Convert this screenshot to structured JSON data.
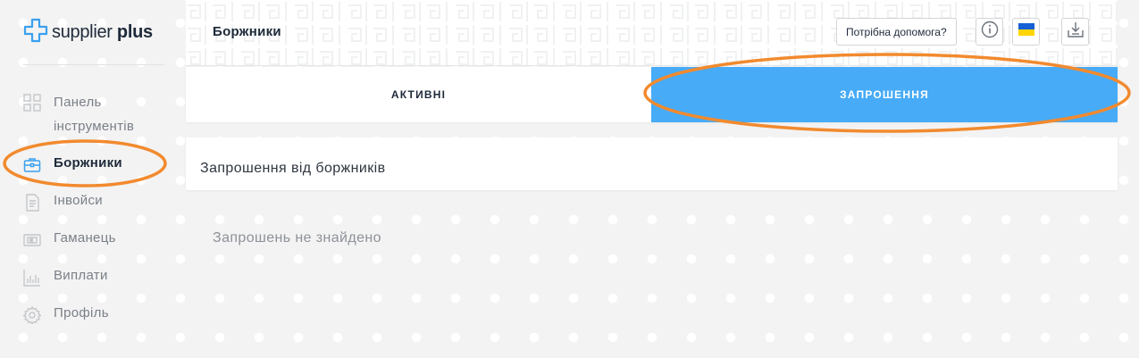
{
  "app": {
    "logo": {
      "word1": "supplier",
      "word2": "plus",
      "icon": "cross-logo-icon"
    }
  },
  "sidebar": {
    "items": [
      {
        "label": "Панель інструментів",
        "icon": "dashboard-grid-icon",
        "active": false
      },
      {
        "label": "Боржники",
        "icon": "briefcase-icon",
        "active": true
      },
      {
        "label": "Інвойси",
        "icon": "document-icon",
        "active": false
      },
      {
        "label": "Гаманець",
        "icon": "wallet-icon",
        "active": false
      },
      {
        "label": "Виплати",
        "icon": "bar-chart-icon",
        "active": false
      },
      {
        "label": "Профіль",
        "icon": "gear-icon",
        "active": false
      }
    ]
  },
  "header": {
    "title": "Боржники",
    "help_label": "Потрібна допомога?",
    "info_icon": "info-icon",
    "flag_icon": "ukraine-flag-icon",
    "download_icon": "download-icon"
  },
  "tabs": [
    {
      "label": "АКТИВНІ",
      "selected": false
    },
    {
      "label": "ЗАПРОШЕННЯ",
      "selected": true
    }
  ],
  "panel": {
    "title": "Запрошення від боржників",
    "empty_message": "Запрошень не знайдено"
  },
  "colors": {
    "accent": "#47abf7",
    "brand_icon": "#3aa0ef",
    "annotation": "#f28a2e",
    "flag_blue": "#1560d4",
    "flag_yellow": "#ffd500"
  }
}
